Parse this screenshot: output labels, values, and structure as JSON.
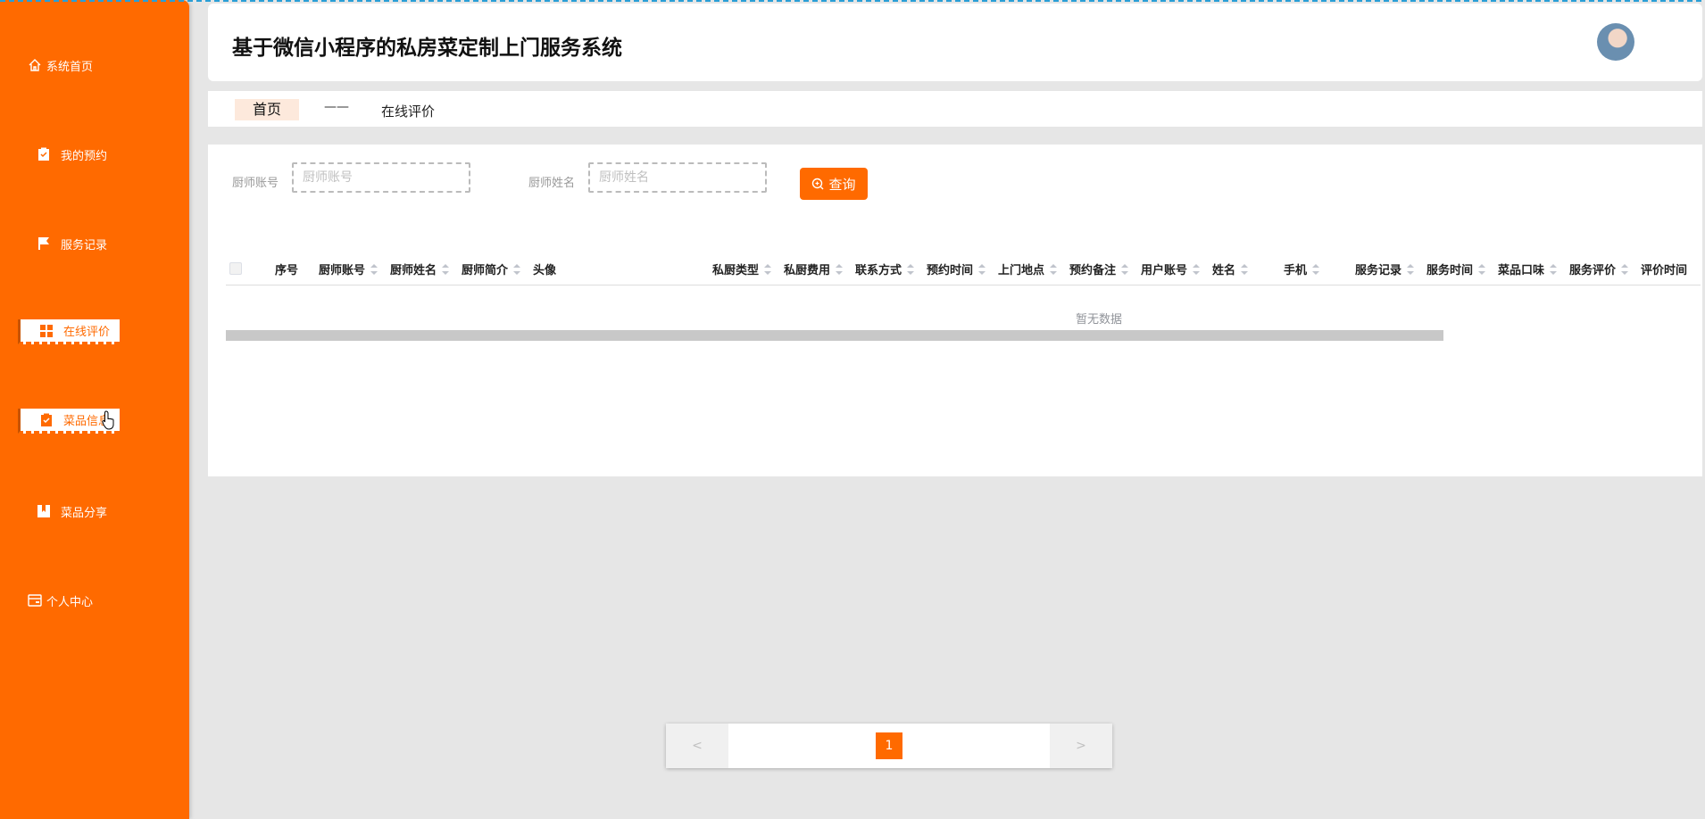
{
  "app": {
    "title": "基于微信小程序的私房菜定制上门服务系统"
  },
  "sidebar": {
    "items": [
      {
        "label": "系统首页",
        "icon": "home-icon"
      },
      {
        "label": "我的预约",
        "icon": "clipboard-icon"
      },
      {
        "label": "服务记录",
        "icon": "flag-icon"
      },
      {
        "label": "在线评价",
        "icon": "grid-icon"
      },
      {
        "label": "菜品信息",
        "icon": "clipboard-check-icon"
      },
      {
        "label": "菜品分享",
        "icon": "book-icon"
      },
      {
        "label": "个人中心",
        "icon": "card-icon"
      }
    ]
  },
  "breadcrumb": {
    "home": "首页",
    "separator": "——",
    "current": "在线评价"
  },
  "search": {
    "chef_account_label": "厨师账号",
    "chef_account_placeholder": "厨师账号",
    "chef_name_label": "厨师姓名",
    "chef_name_placeholder": "厨师姓名",
    "query_label": "查询"
  },
  "table": {
    "columns": [
      "序号",
      "厨师账号",
      "厨师姓名",
      "厨师简介",
      "头像",
      "私厨类型",
      "私厨费用",
      "联系方式",
      "预约时间",
      "上门地点",
      "预约备注",
      "用户账号",
      "姓名",
      "手机",
      "服务记录",
      "服务时间",
      "菜品口味",
      "服务评价",
      "评价时间"
    ],
    "empty_text": "暂无数据"
  },
  "pagination": {
    "prev": "<",
    "next": ">",
    "current_page": "1"
  },
  "colors": {
    "accent": "#ff6a00",
    "background": "#e6e6e6"
  }
}
